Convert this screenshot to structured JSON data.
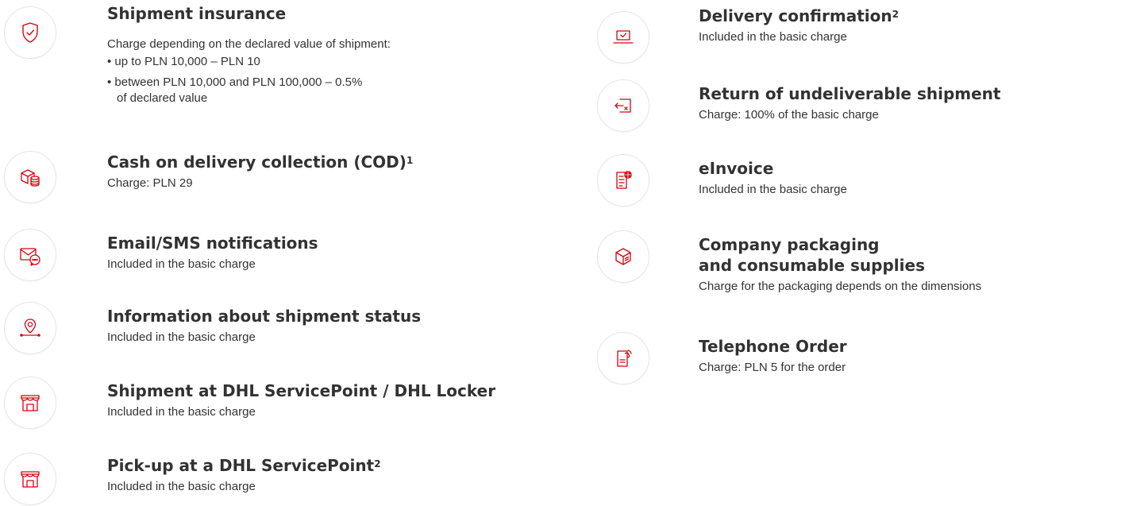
{
  "accent_color": "#d40511",
  "left": [
    {
      "icon": "shield-check-icon",
      "title": "Shipment insurance",
      "description": "Charge depending on the declared value of shipment:",
      "list": [
        "• up to PLN 10,000 – PLN 10",
        "• between PLN 10,000 and PLN 100,000 – 0.5%",
        "of declared value"
      ]
    },
    {
      "icon": "cod-package-coins-icon",
      "title": "Cash on delivery collection (COD)",
      "sup": "1",
      "description": "Charge: PLN 29"
    },
    {
      "icon": "email-chat-icon",
      "title": "Email/SMS notifications",
      "description": "Included in the basic charge"
    },
    {
      "icon": "location-pin-icon",
      "title": "Information about shipment status",
      "description": "Included in the basic charge"
    },
    {
      "icon": "storefront-icon",
      "title": "Shipment at DHL ServicePoint / DHL Locker",
      "description": "Included in the basic charge"
    },
    {
      "icon": "storefront-icon",
      "title": "Pick-up at a DHL ServicePoint",
      "sup": "2",
      "description": "Included in the basic charge"
    }
  ],
  "right": [
    {
      "icon": "laptop-check-icon",
      "title": "Delivery confirmation",
      "sup": "2",
      "description": "Included in the basic charge"
    },
    {
      "icon": "return-arrow-icon",
      "title": "Return of undeliverable shipment",
      "description": "Charge: 100% of the basic charge"
    },
    {
      "icon": "einvoice-document-icon",
      "title": "eInvoice",
      "description": "Included in the basic charge"
    },
    {
      "icon": "packaging-box-icon",
      "title": "Company packaging",
      "title2": "and consumable supplies",
      "description": "Charge for the packaging depends on the dimensions"
    },
    {
      "icon": "telephone-order-icon",
      "title": "Telephone Order",
      "description": "Charge: PLN 5 for the order"
    }
  ]
}
